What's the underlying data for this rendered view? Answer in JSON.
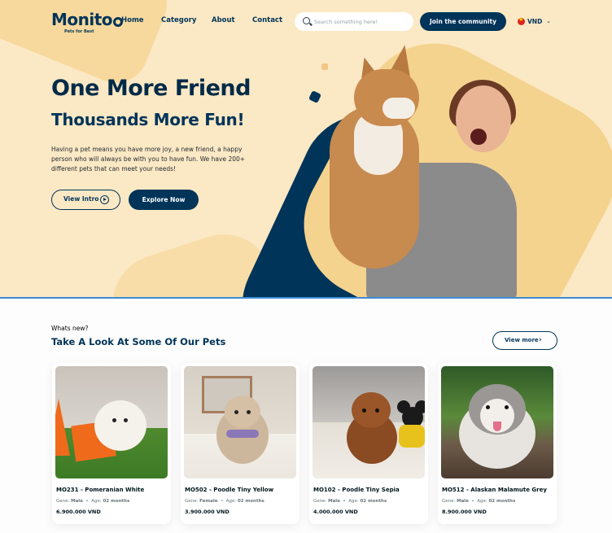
{
  "brand": {
    "name": "Monito",
    "tagline": "Pets for Best"
  },
  "nav": {
    "items": [
      "Home",
      "Category",
      "About",
      "Contact"
    ]
  },
  "search": {
    "placeholder": "Search something here!",
    "value": ""
  },
  "header": {
    "join_label": "Join the community",
    "currency": "VND"
  },
  "hero": {
    "title": "One More Friend",
    "subtitle": "Thousands More Fun!",
    "description": "Having a pet means you have more joy, a new friend, a happy person who will always be with you to have fun. We have 200+ different pets that can meet your needs!",
    "intro_label": "View Intro",
    "explore_label": "Explore Now"
  },
  "section": {
    "eyebrow": "Whats new?",
    "title": "Take A Look At Some Of Our Pets",
    "view_more_label": "View more"
  },
  "pets": [
    {
      "name": "MO231 - Pomeranian White",
      "gene_label": "Gene:",
      "gene": "Male",
      "age_label": "Age:",
      "age": "02 months",
      "price": "6.900.000 VND"
    },
    {
      "name": "MO502 - Poodle Tiny Yellow",
      "gene_label": "Gene:",
      "gene": "Female",
      "age_label": "Age:",
      "age": "02 months",
      "price": "3.900.000 VND"
    },
    {
      "name": "MO102 - Poodle Tiny Sepia",
      "gene_label": "Gene:",
      "gene": "Male",
      "age_label": "Age:",
      "age": "02 months",
      "price": "4.000.000 VND"
    },
    {
      "name": "MO512 - Alaskan Malamute Grey",
      "gene_label": "Gene:",
      "gene": "Male",
      "age_label": "Age:",
      "age": "02 months",
      "price": "8.900.000 VND"
    }
  ],
  "colors": {
    "primary": "#003459",
    "hero_bg": "#fbe8c4",
    "accent_gold": "#f4d38f"
  }
}
